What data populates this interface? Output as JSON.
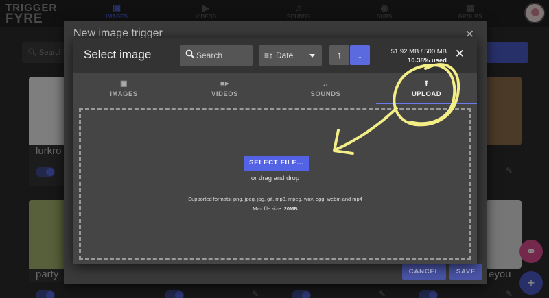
{
  "app": {
    "logo_line1": "TRIGGER",
    "logo_line2": "FYRE",
    "nav": [
      {
        "label": "IMAGES",
        "icon": "image-icon"
      },
      {
        "label": "VIDEOS",
        "icon": "video-icon"
      },
      {
        "label": "SOUNDS",
        "icon": "music-icon"
      },
      {
        "label": "SUBS",
        "icon": "broadcast-icon"
      },
      {
        "label": "GROUPS",
        "icon": "grid-icon"
      }
    ],
    "search_label": "Search",
    "cards": [
      {
        "title": "lurkro"
      },
      {
        "title": "party"
      },
      {
        "title": "eyou"
      }
    ]
  },
  "outer_dialog": {
    "title": "New image trigger",
    "cancel_label": "CANCEL",
    "save_label": "SAVE"
  },
  "modal": {
    "title": "Select image",
    "search_placeholder": "Search",
    "sort_value": "Date",
    "storage_used": "51.92 MB / 500 MB",
    "storage_percent": "10.38% used",
    "tabs": [
      {
        "label": "IMAGES",
        "icon": "image-icon"
      },
      {
        "label": "VIDEOS",
        "icon": "video-icon"
      },
      {
        "label": "SOUNDS",
        "icon": "music-icon"
      },
      {
        "label": "UPLOAD",
        "icon": "upload-icon"
      }
    ],
    "active_tab": "UPLOAD",
    "upload": {
      "button_label": "SELECT FILE...",
      "drag_text": "or drag and drop",
      "formats_text": "Supported formats: png, jpeg, jpg, gif, mp3, mpeg, wav, ogg, webm and mp4",
      "max_label": "Max file size: ",
      "max_value": "20MB"
    }
  },
  "colors": {
    "accent": "#5c6ae0",
    "annotation": "#f3ee86"
  }
}
